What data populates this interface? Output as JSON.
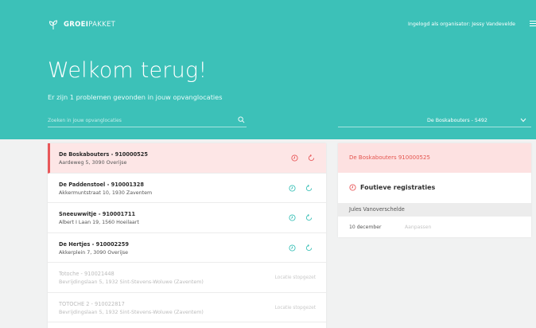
{
  "header": {
    "logo_bold": "GROEI",
    "logo_light": "PAKKET",
    "user_label": "Ingelogd als organisator: Jessy Vandevelde",
    "welcome": "Welkom terug!",
    "problems": "Er zijn 1 problemen gevonden in jouw opvanglocaties"
  },
  "search": {
    "placeholder": "Zoeken in jouw opvanglocaties"
  },
  "location_select": {
    "value": "De Boskabouters - 5492"
  },
  "colors": {
    "brand": "#3cc1b8",
    "error": "#e8585a",
    "error_bg": "#fde6e6"
  },
  "locations": [
    {
      "name": "De Boskabouters - 910000525",
      "address": "Aardeweg 5, 3090 Overijse"
    },
    {
      "name": "De Paddenstoel - 910001328",
      "address": "Akkermuntstraat 10, 1930 Zaventem"
    },
    {
      "name": "Sneeuwwitje - 910001711",
      "address": "Albert I Laan 19, 1560 Hoeilaart"
    },
    {
      "name": "De Hertjes - 910002259",
      "address": "Akkerplein 7, 3090 Overijse"
    },
    {
      "name": "Totoche - 910021448",
      "address": "Bevrijdingslaan 5, 1932 Sint-Stevens-Woluwe (Zaventem)",
      "status": "Locatie stopgezet"
    },
    {
      "name": "TOTOCHE 2 - 910022817",
      "address": "Bevrijdingslaan 5, 1932 Sint-Stevens-Woluwe (Zaventem)",
      "status": "Locatie stopgezet"
    }
  ],
  "detail": {
    "title": "De Boskabouters 910000525",
    "error_heading": "Foutieve registraties",
    "person": "Jules Vanoverschelde",
    "date": "10 december",
    "edit": "Aanpassen"
  }
}
